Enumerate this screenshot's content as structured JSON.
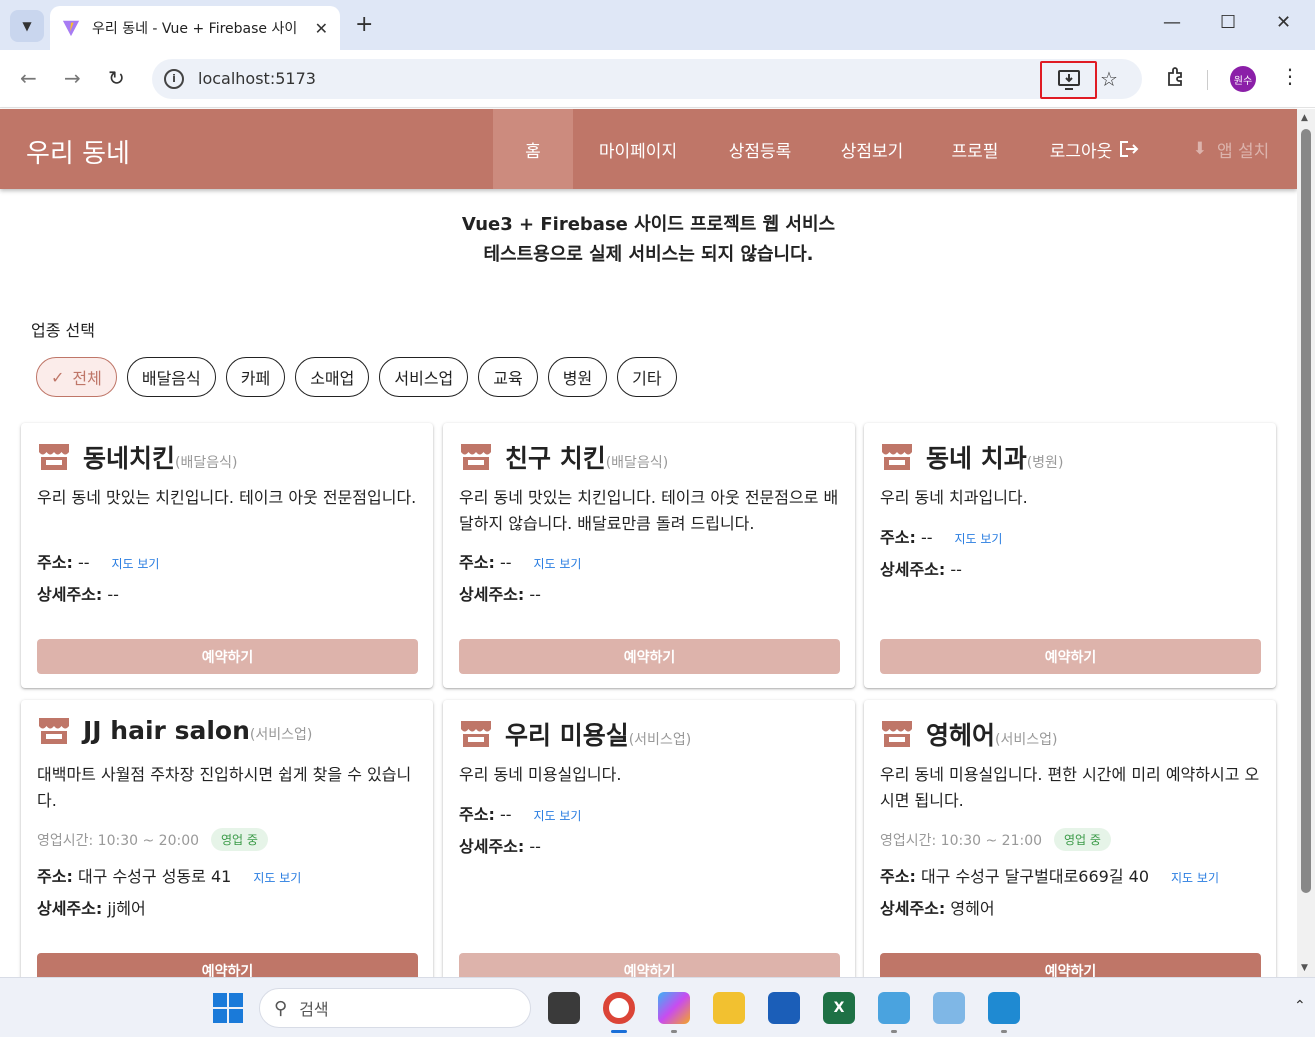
{
  "browser": {
    "tab_title": "우리 동네 - Vue + Firebase 사이",
    "url": "localhost:5173",
    "profile_initials": "원수"
  },
  "nav": {
    "brand": "우리 동네",
    "items": [
      "홈",
      "마이페이지",
      "상점등록",
      "상점보기",
      "프로필"
    ],
    "logout": "로그아웃",
    "install": "앱 설치"
  },
  "intro": {
    "line1": "Vue3 + Firebase 사이드 프로젝트 웹 서비스",
    "line2": "테스트용으로 실제 서비스는 되지 않습니다."
  },
  "category": {
    "label": "업종 선택",
    "chips": [
      "전체",
      "배달음식",
      "카페",
      "소매업",
      "서비스업",
      "교육",
      "병원",
      "기타"
    ],
    "selected": "전체"
  },
  "labels": {
    "address": "주소:",
    "detail": "상세주소:",
    "map": "지도 보기",
    "reserve": "예약하기",
    "open_badge": "영업 중"
  },
  "stores": [
    {
      "name": "동네치킨",
      "category": "(배달음식)",
      "desc": "우리 동네 맛있는 치킨입니다. 테이크 아웃 전문점입니다.",
      "hours": "",
      "address": "--",
      "detail": "--"
    },
    {
      "name": "친구 치킨",
      "category": "(배달음식)",
      "desc": "우리 동네 맛있는 치킨입니다. 테이크 아웃 전문점으로 배달하지 않습니다. 배달료만큼 돌려 드립니다.",
      "hours": "",
      "address": "--",
      "detail": "--"
    },
    {
      "name": "동네 치과",
      "category": "(병원)",
      "desc": "우리 동네 치과입니다.",
      "hours": "",
      "address": "--",
      "detail": "--"
    },
    {
      "name": "JJ hair salon",
      "category": "(서비스업)",
      "desc": "대백마트 사월점 주차장 진입하시면 쉽게 찾을 수 있습니다.",
      "hours": "영업시간: 10:30 ~ 20:00",
      "address": "대구 수성구 성동로 41",
      "detail": "jj헤어"
    },
    {
      "name": "우리 미용실",
      "category": "(서비스업)",
      "desc": "우리 동네 미용실입니다.",
      "hours": "",
      "address": "--",
      "detail": "--"
    },
    {
      "name": "영헤어",
      "category": "(서비스업)",
      "desc": "우리 동네 미용실입니다. 편한 시간에 미리 예약하시고 오시면 됩니다.",
      "hours": "영업시간: 10:30 ~ 21:00",
      "address": "대구 수성구 달구벌대로669길 40",
      "detail": "영헤어"
    }
  ],
  "taskbar": {
    "search_placeholder": "검색"
  },
  "colors": {
    "brand": "#bf7668",
    "reserve_light": "#ddb3ab",
    "link": "#2a7de1",
    "open_badge": "#3a9a47"
  }
}
